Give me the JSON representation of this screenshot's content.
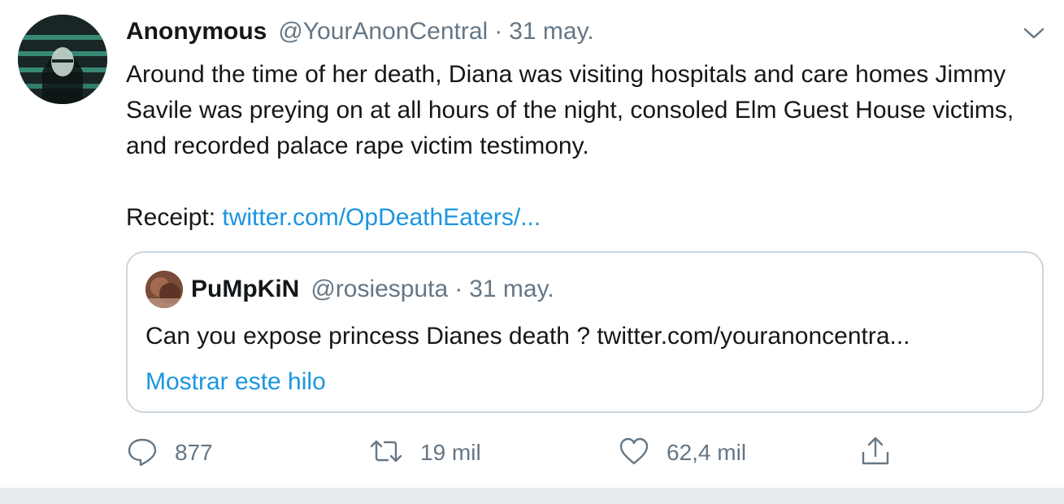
{
  "tweet": {
    "author_name": "Anonymous",
    "author_handle": "@YourAnonCentral",
    "separator": "·",
    "date": "31 may.",
    "text_line1": "Around the time of her death, Diana was visiting hospitals and care homes Jimmy Savile was preying on at all hours of the night, consoled Elm Guest House victims, and recorded palace rape victim testimony.",
    "receipt_label": "Receipt: ",
    "receipt_link": "twitter.com/OpDeathEaters/..."
  },
  "quoted_tweet": {
    "author_name": "PuMpKiN",
    "author_handle": "@rosiesputa",
    "separator": "·",
    "date": "31 may.",
    "text": "Can you expose princess Dianes death ? twitter.com/youranoncentra...",
    "show_thread": "Mostrar este hilo"
  },
  "actions": {
    "reply_count": "877",
    "retweet_count": "19 mil",
    "like_count": "62,4 mil"
  },
  "colors": {
    "link": "#1b95e0",
    "secondary_text": "#657786",
    "border": "#ccd6dd",
    "bottom_bar": "#e6ecf0"
  },
  "icons": [
    "chevron-down-icon",
    "reply-icon",
    "retweet-icon",
    "like-icon",
    "share-icon"
  ]
}
